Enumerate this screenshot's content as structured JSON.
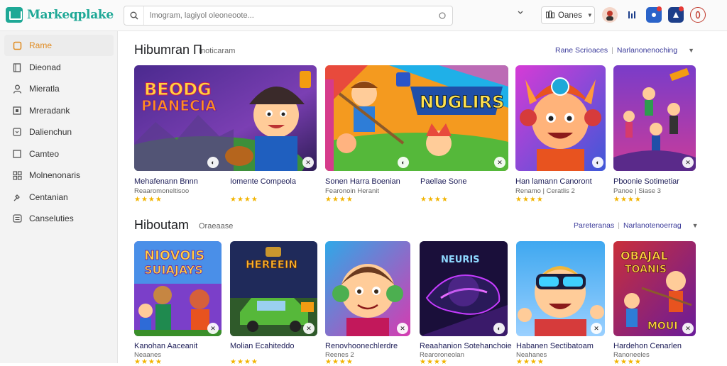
{
  "app": {
    "name": "Markeqplake"
  },
  "search": {
    "text": "lmogram, lagiyol oleoneoote..."
  },
  "header": {
    "games_label": "Oanes"
  },
  "colors": {
    "accent": "#1ea896",
    "active": "#e08a1e",
    "star": "#f2b400",
    "link": "#3b3b9a"
  },
  "sidebar": {
    "items": [
      {
        "label": "Rame",
        "icon": "home-icon",
        "active": true
      },
      {
        "label": "Dieonad",
        "icon": "document-icon"
      },
      {
        "label": "Mieratla",
        "icon": "user-icon"
      },
      {
        "label": "Mreradank",
        "icon": "calendar-icon"
      },
      {
        "label": "Dalienchun",
        "icon": "chart-icon"
      },
      {
        "label": "Camteo",
        "icon": "square-icon"
      },
      {
        "label": "Molnenonaris",
        "icon": "grid-icon"
      },
      {
        "label": "Centanian",
        "icon": "pin-icon"
      },
      {
        "label": "Canseluties",
        "icon": "list-icon"
      }
    ]
  },
  "sections": [
    {
      "title": "Hibumran П",
      "subtitle": "Inoticaram",
      "link_a": "Rane Scrioaces",
      "link_b": "Narlanonenoching",
      "cards": [
        {
          "title": "Mehafenann Bnnn",
          "meta": "Reaaromoneltisoo",
          "stars": "★★★★"
        },
        {
          "title": "Iomente Compeola",
          "meta": "",
          "stars": "★★★★"
        },
        {
          "title": "Sonen Harra Boenian",
          "meta": "Fearonoin Heranit",
          "stars": "★★★★"
        },
        {
          "title": "Paellae Sone",
          "meta": "",
          "stars": "★★★★"
        },
        {
          "title": "Han lamann Canoront",
          "meta": "Renamo | Ceratlis 2",
          "stars": "★★★★"
        },
        {
          "title": "Pboonie Sotimetiar",
          "meta": "Panoe | Siase 3",
          "stars": "★★★★"
        }
      ]
    },
    {
      "title": "Hiboutam",
      "subtitle": "Oraeaase",
      "link_a": "Pareteranas",
      "link_b": "Narlanotenoerrag",
      "cards": [
        {
          "title": "Kanohan Aaceanit",
          "meta": "Neaanes",
          "stars": "★★★★"
        },
        {
          "title": "Molian Ecahiteddo",
          "meta": "",
          "stars": "★★★★"
        },
        {
          "title": "Renovhoonechlerdre",
          "meta": "Reenes 2",
          "stars": "★★★★"
        },
        {
          "title": "Reaahanion Sotehanchoie",
          "meta": "Rearoroneolan",
          "stars": "★★★★"
        },
        {
          "title": "Habanen Sectibatoam",
          "meta": "Neahanes",
          "stars": "★★★★"
        },
        {
          "title": "Hardehon Cenarlen",
          "meta": "Ranoneeles",
          "stars": "★★★★"
        }
      ]
    }
  ]
}
